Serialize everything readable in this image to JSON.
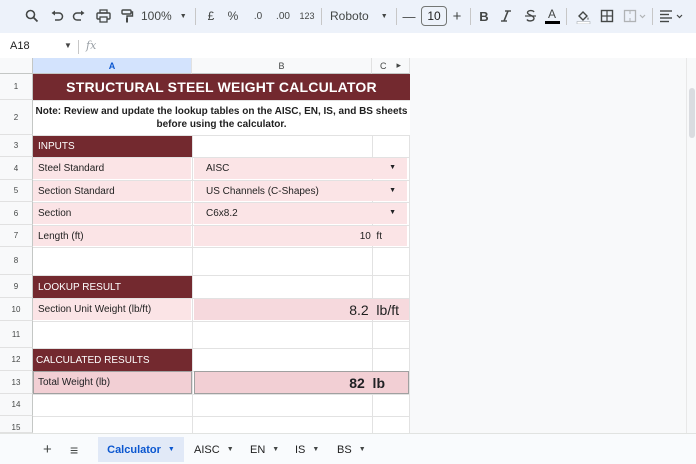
{
  "toolbar": {
    "zoom": "100%",
    "currency": "£",
    "percent": "%",
    "decrease_decimals": ".0",
    "increase_decimals": ".00",
    "number_format": "123",
    "font": "Roboto",
    "font_size": "10",
    "minus": "—",
    "plus": "+",
    "bold": "B",
    "text_color_letter": "A",
    "text_color": "#000000"
  },
  "formula_bar": {
    "cell_ref": "A18",
    "fx": "fx",
    "value": ""
  },
  "columns": [
    "A",
    "B",
    "C"
  ],
  "rows": [
    "1",
    "2",
    "3",
    "4",
    "5",
    "6",
    "7",
    "8",
    "9",
    "10",
    "11",
    "12",
    "13",
    "14",
    "15"
  ],
  "sheet": {
    "title": "STRUCTURAL STEEL WEIGHT CALCULATOR",
    "note_line1": "Note: Review and update the lookup tables on the AISC, EN, IS, and BS sheets",
    "note_line2": "before using the calculator.",
    "inputs_header": "INPUTS",
    "steel_standard_label": "Steel Standard",
    "steel_standard_value": "AISC",
    "section_standard_label": "Section Standard",
    "section_standard_value": "US Channels (C-Shapes)",
    "section_label": "Section",
    "section_value": "C6x8.2",
    "length_label": "Length (ft)",
    "length_value": "10  ft",
    "lookup_header": "LOOKUP RESULT",
    "unit_weight_label": "Section Unit Weight (lb/ft)",
    "unit_weight_value": "8.2  lb/ft",
    "calc_header": "CALCULATED RESULTS",
    "total_weight_label": "Total Weight (lb)",
    "total_weight_value": "82  lb"
  },
  "tabs": {
    "add": "+",
    "all_sheets": "≡",
    "items": [
      "Calculator",
      "AISC",
      "EN",
      "IS",
      "BS"
    ],
    "active": "Calculator"
  },
  "colors": {
    "header_maroon": "#73292f",
    "input_pink": "#fbe4e6",
    "total_pink": "#f2cfd4",
    "accent_blue": "#0b57d0"
  },
  "icons": [
    "search-icon",
    "undo-icon",
    "redo-icon",
    "print-icon",
    "paint-format-icon",
    "fill-color-icon",
    "borders-icon",
    "merge-cells-icon",
    "align-icon"
  ]
}
